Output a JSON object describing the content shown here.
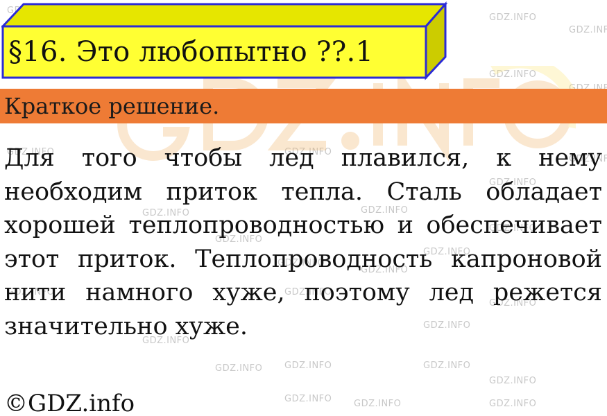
{
  "header": {
    "title": "§16. Это любопытно ??.1"
  },
  "section": {
    "label": "Краткое решение."
  },
  "content": {
    "paragraph": "Для того чтобы лед плавился, к нему необходим приток тепла. Сталь обладает хорошей теплопроводностью и обеспечивает этот приток. Теплопроводность капроновой нити намного хуже, поэтому лед режется значительно хуже."
  },
  "footer": {
    "copyright": "©GDZ.info"
  },
  "watermark": {
    "text": "GDZ.INFO"
  },
  "colors": {
    "title_face": "#ffff33",
    "title_border": "#2b2bd6",
    "band": "#ee7b35",
    "watermark": "#c8c8c8"
  }
}
